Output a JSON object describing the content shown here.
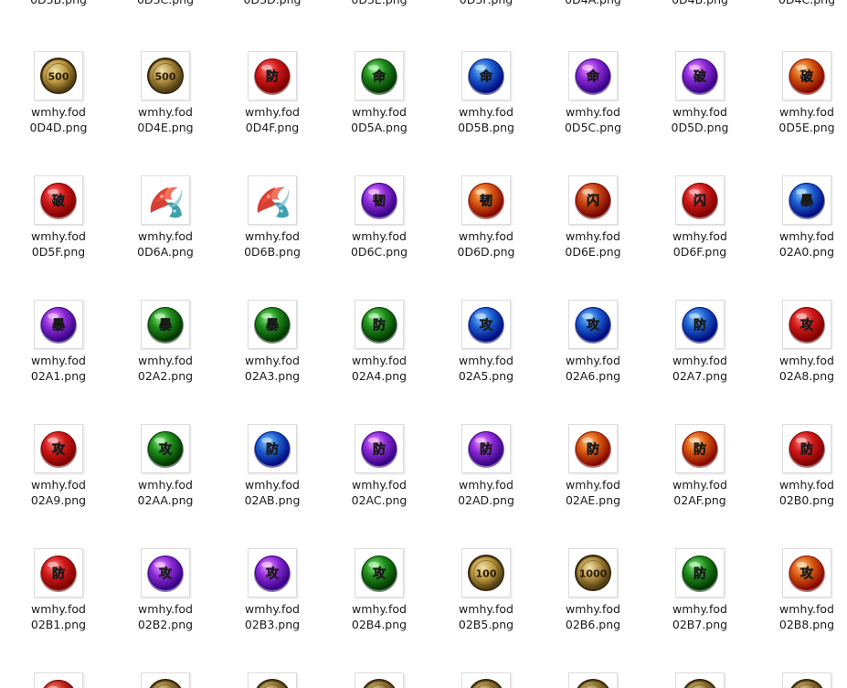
{
  "top_partial_labels": [
    "0D3B.png",
    "0D3C.png",
    "0D3D.png",
    "0D3E.png",
    "0D3F.png",
    "0D4A.png",
    "0D4B.png",
    "0D4C.png"
  ],
  "files": [
    {
      "line1": "wmhy.fod",
      "line2": "0D4D.png",
      "icon": "coin-500-icon",
      "kind": "coin",
      "color": "#b8963c",
      "text": "500"
    },
    {
      "line1": "wmhy.fod",
      "line2": "0D4E.png",
      "icon": "coin-500-icon",
      "kind": "coin",
      "color": "#a8873a",
      "text": "500"
    },
    {
      "line1": "wmhy.fod",
      "line2": "0D4F.png",
      "icon": "red-defense-orb-icon",
      "kind": "orb",
      "color": "#d01818",
      "text": "防"
    },
    {
      "line1": "wmhy.fod",
      "line2": "0D5A.png",
      "icon": "green-life-orb-icon",
      "kind": "orb",
      "color": "#1f8a1a",
      "text": "命"
    },
    {
      "line1": "wmhy.fod",
      "line2": "0D5B.png",
      "icon": "blue-life-orb-icon",
      "kind": "orb",
      "color": "#1c5fd0",
      "text": "命"
    },
    {
      "line1": "wmhy.fod",
      "line2": "0D5C.png",
      "icon": "purple-life-orb-icon",
      "kind": "orb",
      "color": "#8a2ad6",
      "text": "命"
    },
    {
      "line1": "wmhy.fod",
      "line2": "0D5D.png",
      "icon": "purple-break-orb-icon",
      "kind": "orb",
      "color": "#8a2ad6",
      "text": "破"
    },
    {
      "line1": "wmhy.fod",
      "line2": "0D5E.png",
      "icon": "orange-break-orb-icon",
      "kind": "orb",
      "color": "#d8580e",
      "text": "破"
    },
    {
      "line1": "wmhy.fod",
      "line2": "0D5F.png",
      "icon": "red-break-orb-icon",
      "kind": "orb",
      "color": "#d01818",
      "text": "破"
    },
    {
      "line1": "wmhy.fod",
      "line2": "0D6A.png",
      "icon": "fire-water-swirl-icon",
      "kind": "swirl",
      "color": "#d23020",
      "text": ""
    },
    {
      "line1": "wmhy.fod",
      "line2": "0D6B.png",
      "icon": "fire-water-swirl-icon",
      "kind": "swirl",
      "color": "#d23020",
      "text": ""
    },
    {
      "line1": "wmhy.fod",
      "line2": "0D6C.png",
      "icon": "purple-tough-orb-icon",
      "kind": "orb",
      "color": "#8a2ad6",
      "text": "韧"
    },
    {
      "line1": "wmhy.fod",
      "line2": "0D6D.png",
      "icon": "orange-tough-orb-icon",
      "kind": "orb",
      "color": "#d8580e",
      "text": "韧"
    },
    {
      "line1": "wmhy.fod",
      "line2": "0D6E.png",
      "icon": "orange-dodge-orb-icon",
      "kind": "orb",
      "color": "#c8400e",
      "text": "闪"
    },
    {
      "line1": "wmhy.fod",
      "line2": "0D6F.png",
      "icon": "red-dodge-orb-icon",
      "kind": "orb",
      "color": "#d01818",
      "text": "闪"
    },
    {
      "line1": "wmhy.fod",
      "line2": "02A0.png",
      "icon": "blue-crit-orb-icon",
      "kind": "orb",
      "color": "#1c5fd0",
      "text": "暴"
    },
    {
      "line1": "wmhy.fod",
      "line2": "02A1.png",
      "icon": "purple-crit-orb-icon",
      "kind": "orb",
      "color": "#8a2ad6",
      "text": "暴"
    },
    {
      "line1": "wmhy.fod",
      "line2": "02A2.png",
      "icon": "green-crit-orb-icon",
      "kind": "orb",
      "color": "#1f8a1a",
      "text": "暴"
    },
    {
      "line1": "wmhy.fod",
      "line2": "02A3.png",
      "icon": "green-crit-orb-icon",
      "kind": "orb",
      "color": "#1f8a1a",
      "text": "暴"
    },
    {
      "line1": "wmhy.fod",
      "line2": "02A4.png",
      "icon": "green-defense-orb-icon",
      "kind": "orb",
      "color": "#1f8a1a",
      "text": "防"
    },
    {
      "line1": "wmhy.fod",
      "line2": "02A5.png",
      "icon": "blue-attack-orb-icon",
      "kind": "orb",
      "color": "#1c5fd0",
      "text": "攻"
    },
    {
      "line1": "wmhy.fod",
      "line2": "02A6.png",
      "icon": "blue-attack-orb-icon",
      "kind": "orb",
      "color": "#1c5fd0",
      "text": "攻"
    },
    {
      "line1": "wmhy.fod",
      "line2": "02A7.png",
      "icon": "blue-defense-orb-icon",
      "kind": "orb",
      "color": "#1c5fd0",
      "text": "防"
    },
    {
      "line1": "wmhy.fod",
      "line2": "02A8.png",
      "icon": "red-attack-orb-icon",
      "kind": "orb",
      "color": "#d01818",
      "text": "攻"
    },
    {
      "line1": "wmhy.fod",
      "line2": "02A9.png",
      "icon": "red-attack-orb-icon",
      "kind": "orb",
      "color": "#d01818",
      "text": "攻"
    },
    {
      "line1": "wmhy.fod",
      "line2": "02AA.png",
      "icon": "green-attack-orb-icon",
      "kind": "orb",
      "color": "#1f8a1a",
      "text": "攻"
    },
    {
      "line1": "wmhy.fod",
      "line2": "02AB.png",
      "icon": "blue-defense-orb-icon",
      "kind": "orb",
      "color": "#1c5fd0",
      "text": "防"
    },
    {
      "line1": "wmhy.fod",
      "line2": "02AC.png",
      "icon": "purple-defense-orb-icon",
      "kind": "orb",
      "color": "#8a2ad6",
      "text": "防"
    },
    {
      "line1": "wmhy.fod",
      "line2": "02AD.png",
      "icon": "purple-defense-orb-icon",
      "kind": "orb",
      "color": "#8a2ad6",
      "text": "防"
    },
    {
      "line1": "wmhy.fod",
      "line2": "02AE.png",
      "icon": "orange-defense-orb-icon",
      "kind": "orb",
      "color": "#d8580e",
      "text": "防"
    },
    {
      "line1": "wmhy.fod",
      "line2": "02AF.png",
      "icon": "orange-defense-orb-icon",
      "kind": "orb",
      "color": "#d8580e",
      "text": "防"
    },
    {
      "line1": "wmhy.fod",
      "line2": "02B0.png",
      "icon": "red-defense-orb-icon",
      "kind": "orb",
      "color": "#d01818",
      "text": "防"
    },
    {
      "line1": "wmhy.fod",
      "line2": "02B1.png",
      "icon": "red-defense-orb-icon",
      "kind": "orb",
      "color": "#d01818",
      "text": "防"
    },
    {
      "line1": "wmhy.fod",
      "line2": "02B2.png",
      "icon": "purple-attack-orb-icon",
      "kind": "orb",
      "color": "#8a2ad6",
      "text": "攻"
    },
    {
      "line1": "wmhy.fod",
      "line2": "02B3.png",
      "icon": "purple-attack-orb-icon",
      "kind": "orb",
      "color": "#8a2ad6",
      "text": "攻"
    },
    {
      "line1": "wmhy.fod",
      "line2": "02B4.png",
      "icon": "green-attack-orb-icon",
      "kind": "orb",
      "color": "#1f8a1a",
      "text": "攻"
    },
    {
      "line1": "wmhy.fod",
      "line2": "02B5.png",
      "icon": "coin-100-icon",
      "kind": "coin",
      "color": "#b8963c",
      "text": "100"
    },
    {
      "line1": "wmhy.fod",
      "line2": "02B6.png",
      "icon": "coin-1000-icon",
      "kind": "coin",
      "color": "#a8873a",
      "text": "1000"
    },
    {
      "line1": "wmhy.fod",
      "line2": "02B7.png",
      "icon": "green-defense-orb-icon",
      "kind": "orb",
      "color": "#1f8a1a",
      "text": "防"
    },
    {
      "line1": "wmhy.fod",
      "line2": "02B8.png",
      "icon": "orange-attack-orb-icon",
      "kind": "orb",
      "color": "#d8580e",
      "text": "攻"
    }
  ],
  "bottom_partial_icons": [
    {
      "icon": "red-orb-icon",
      "kind": "orb",
      "color": "#c0281a"
    },
    {
      "icon": "coin-icon",
      "kind": "coin",
      "color": "#8a6f2e"
    },
    {
      "icon": "coin-icon",
      "kind": "coin",
      "color": "#8a6f2e"
    },
    {
      "icon": "coin-icon",
      "kind": "coin",
      "color": "#8a6f2e"
    },
    {
      "icon": "coin-icon",
      "kind": "coin",
      "color": "#8a6f2e"
    },
    {
      "icon": "coin-icon",
      "kind": "coin",
      "color": "#8a6f2e"
    },
    {
      "icon": "coin-icon",
      "kind": "coin",
      "color": "#8a6f2e"
    },
    {
      "icon": "coin-icon",
      "kind": "coin",
      "color": "#8a6f2e"
    }
  ]
}
